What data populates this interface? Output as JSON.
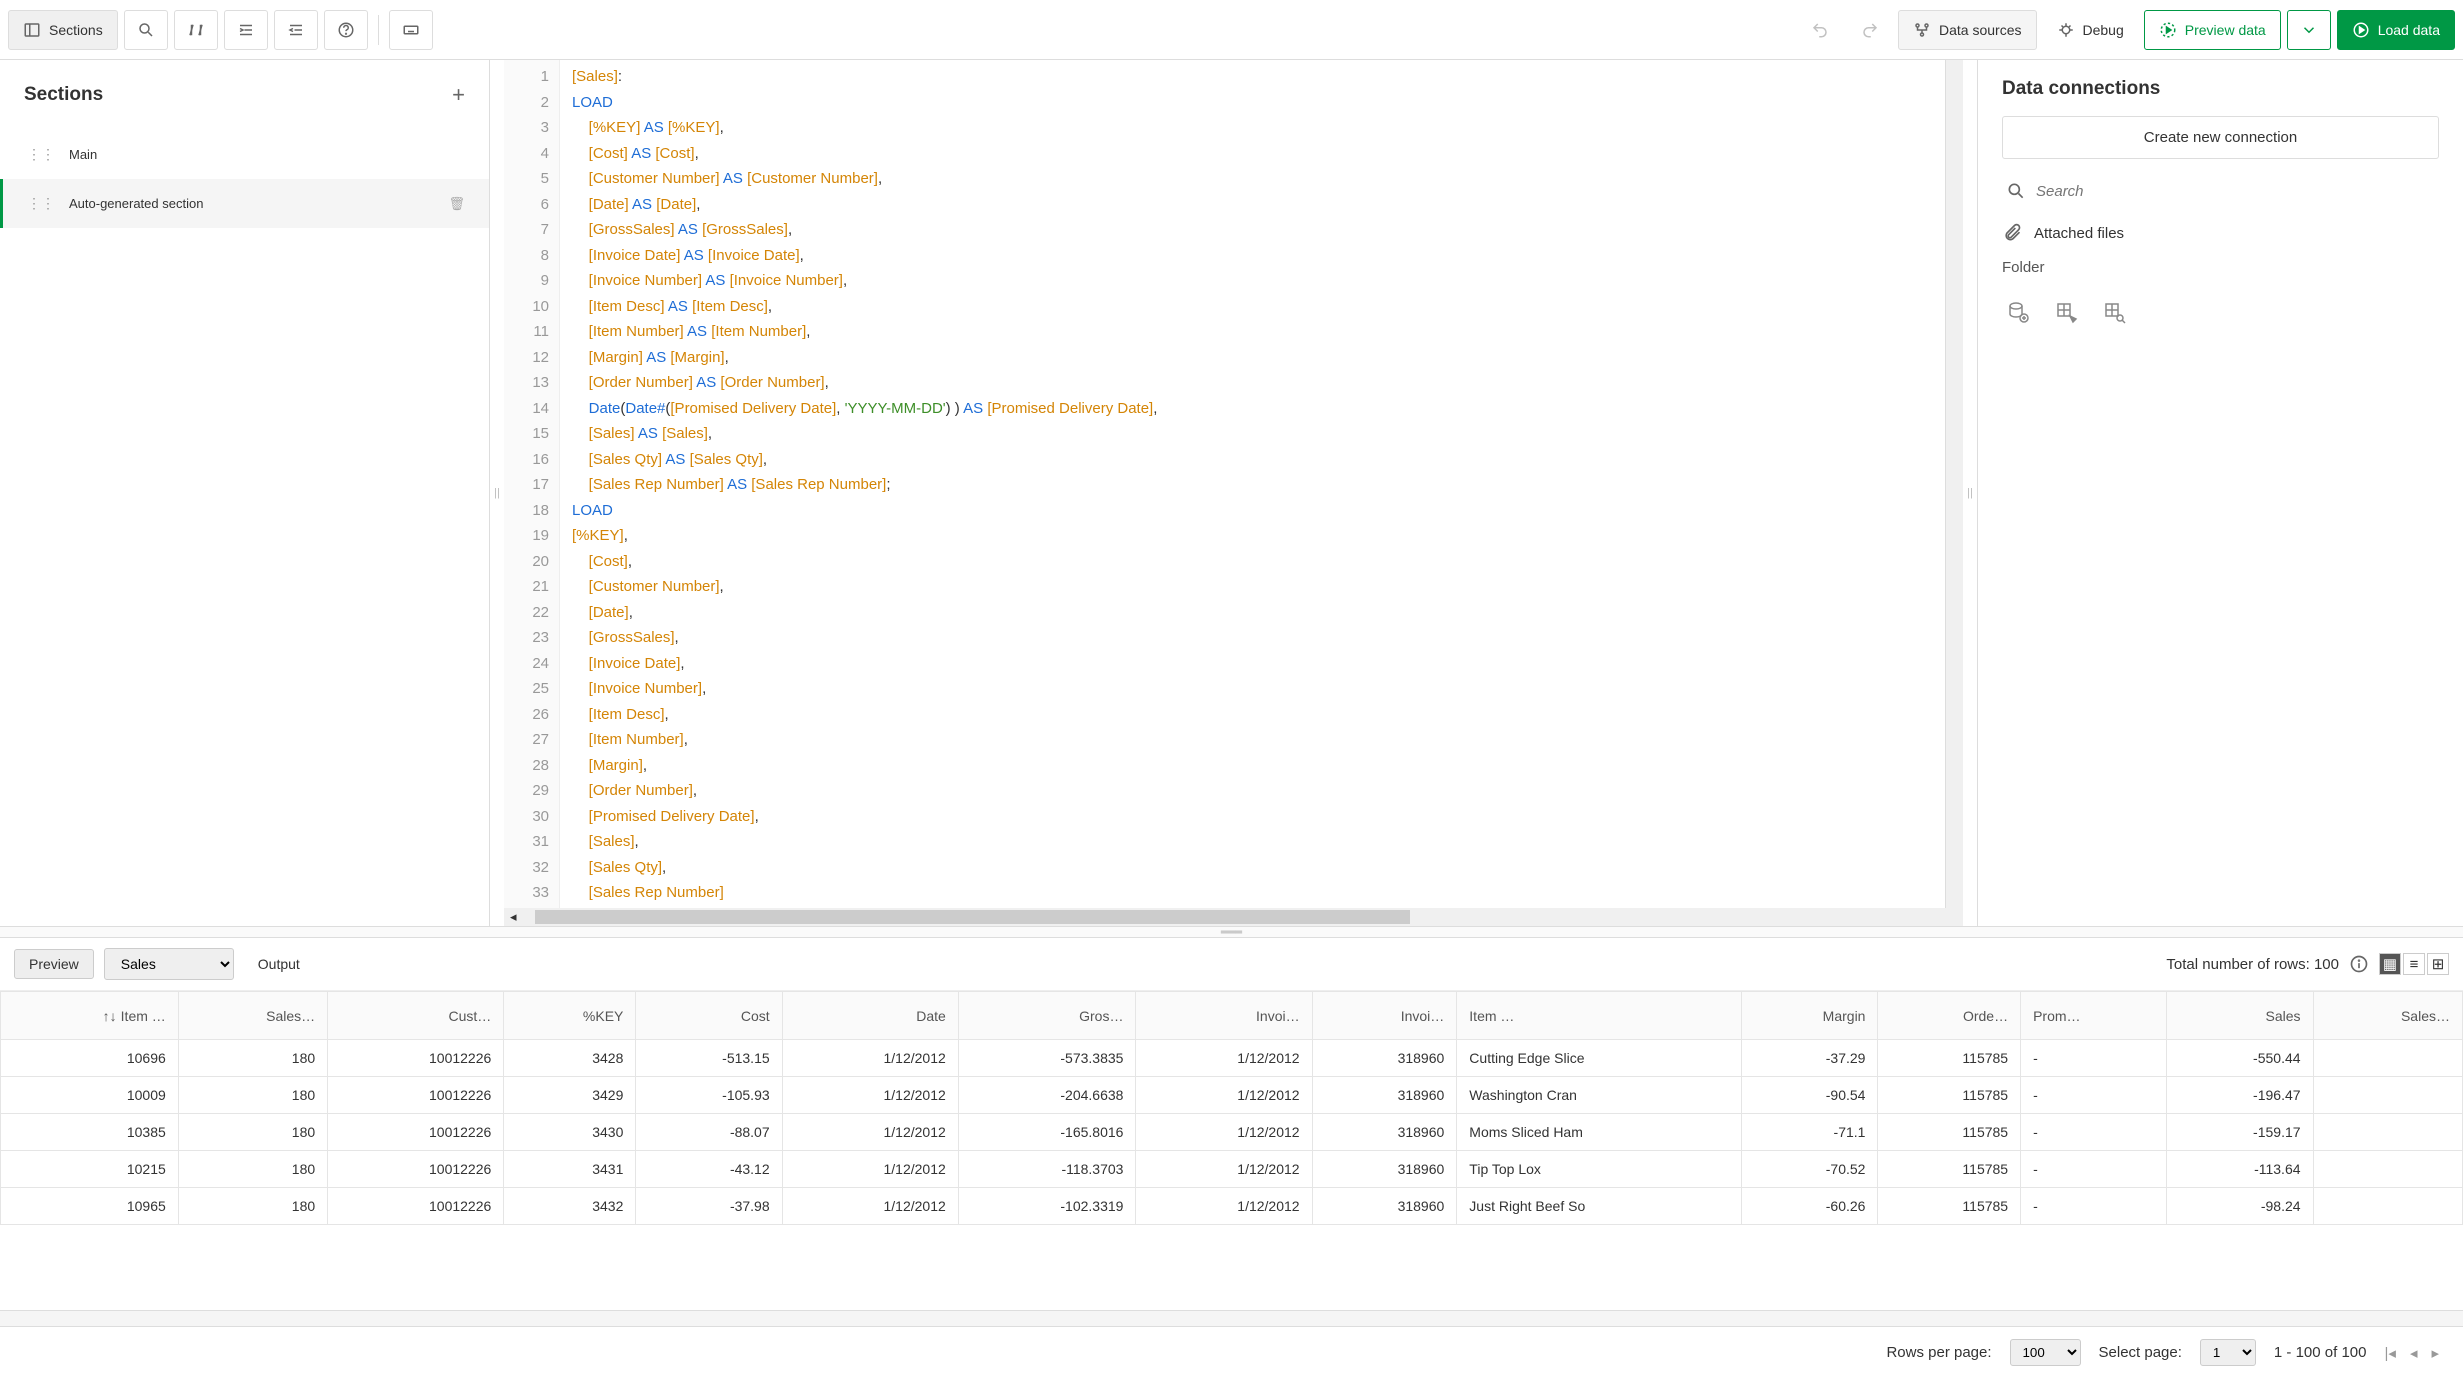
{
  "toolbar": {
    "sections_label": "Sections",
    "data_sources_label": "Data sources",
    "debug_label": "Debug",
    "preview_label": "Preview data",
    "load_label": "Load data"
  },
  "sidebar": {
    "title": "Sections",
    "items": [
      {
        "label": "Main"
      },
      {
        "label": "Auto-generated section"
      }
    ]
  },
  "editor": {
    "lines": [
      [
        {
          "t": "[Sales]",
          "c": "tk-orange"
        },
        {
          "t": ":",
          "c": ""
        }
      ],
      [
        {
          "t": "LOAD",
          "c": "tk-blue"
        }
      ],
      [
        {
          "t": "    ",
          "c": ""
        },
        {
          "t": "[%KEY]",
          "c": "tk-orange"
        },
        {
          "t": " ",
          "c": ""
        },
        {
          "t": "AS",
          "c": "tk-blue"
        },
        {
          "t": " ",
          "c": ""
        },
        {
          "t": "[%KEY]",
          "c": "tk-orange"
        },
        {
          "t": ",",
          "c": ""
        }
      ],
      [
        {
          "t": "    ",
          "c": ""
        },
        {
          "t": "[Cost]",
          "c": "tk-orange"
        },
        {
          "t": " ",
          "c": ""
        },
        {
          "t": "AS",
          "c": "tk-blue"
        },
        {
          "t": " ",
          "c": ""
        },
        {
          "t": "[Cost]",
          "c": "tk-orange"
        },
        {
          "t": ",",
          "c": ""
        }
      ],
      [
        {
          "t": "    ",
          "c": ""
        },
        {
          "t": "[Customer Number]",
          "c": "tk-orange"
        },
        {
          "t": " ",
          "c": ""
        },
        {
          "t": "AS",
          "c": "tk-blue"
        },
        {
          "t": " ",
          "c": ""
        },
        {
          "t": "[Customer Number]",
          "c": "tk-orange"
        },
        {
          "t": ",",
          "c": ""
        }
      ],
      [
        {
          "t": "    ",
          "c": ""
        },
        {
          "t": "[Date]",
          "c": "tk-orange"
        },
        {
          "t": " ",
          "c": ""
        },
        {
          "t": "AS",
          "c": "tk-blue"
        },
        {
          "t": " ",
          "c": ""
        },
        {
          "t": "[Date]",
          "c": "tk-orange"
        },
        {
          "t": ",",
          "c": ""
        }
      ],
      [
        {
          "t": "    ",
          "c": ""
        },
        {
          "t": "[GrossSales]",
          "c": "tk-orange"
        },
        {
          "t": " ",
          "c": ""
        },
        {
          "t": "AS",
          "c": "tk-blue"
        },
        {
          "t": " ",
          "c": ""
        },
        {
          "t": "[GrossSales]",
          "c": "tk-orange"
        },
        {
          "t": ",",
          "c": ""
        }
      ],
      [
        {
          "t": "    ",
          "c": ""
        },
        {
          "t": "[Invoice Date]",
          "c": "tk-orange"
        },
        {
          "t": " ",
          "c": ""
        },
        {
          "t": "AS",
          "c": "tk-blue"
        },
        {
          "t": " ",
          "c": ""
        },
        {
          "t": "[Invoice Date]",
          "c": "tk-orange"
        },
        {
          "t": ",",
          "c": ""
        }
      ],
      [
        {
          "t": "    ",
          "c": ""
        },
        {
          "t": "[Invoice Number]",
          "c": "tk-orange"
        },
        {
          "t": " ",
          "c": ""
        },
        {
          "t": "AS",
          "c": "tk-blue"
        },
        {
          "t": " ",
          "c": ""
        },
        {
          "t": "[Invoice Number]",
          "c": "tk-orange"
        },
        {
          "t": ",",
          "c": ""
        }
      ],
      [
        {
          "t": "    ",
          "c": ""
        },
        {
          "t": "[Item Desc]",
          "c": "tk-orange"
        },
        {
          "t": " ",
          "c": ""
        },
        {
          "t": "AS",
          "c": "tk-blue"
        },
        {
          "t": " ",
          "c": ""
        },
        {
          "t": "[Item Desc]",
          "c": "tk-orange"
        },
        {
          "t": ",",
          "c": ""
        }
      ],
      [
        {
          "t": "    ",
          "c": ""
        },
        {
          "t": "[Item Number]",
          "c": "tk-orange"
        },
        {
          "t": " ",
          "c": ""
        },
        {
          "t": "AS",
          "c": "tk-blue"
        },
        {
          "t": " ",
          "c": ""
        },
        {
          "t": "[Item Number]",
          "c": "tk-orange"
        },
        {
          "t": ",",
          "c": ""
        }
      ],
      [
        {
          "t": "    ",
          "c": ""
        },
        {
          "t": "[Margin]",
          "c": "tk-orange"
        },
        {
          "t": " ",
          "c": ""
        },
        {
          "t": "AS",
          "c": "tk-blue"
        },
        {
          "t": " ",
          "c": ""
        },
        {
          "t": "[Margin]",
          "c": "tk-orange"
        },
        {
          "t": ",",
          "c": ""
        }
      ],
      [
        {
          "t": "    ",
          "c": ""
        },
        {
          "t": "[Order Number]",
          "c": "tk-orange"
        },
        {
          "t": " ",
          "c": ""
        },
        {
          "t": "AS",
          "c": "tk-blue"
        },
        {
          "t": " ",
          "c": ""
        },
        {
          "t": "[Order Number]",
          "c": "tk-orange"
        },
        {
          "t": ",",
          "c": ""
        }
      ],
      [
        {
          "t": "    ",
          "c": ""
        },
        {
          "t": "Date",
          "c": "tk-blue"
        },
        {
          "t": "(",
          "c": ""
        },
        {
          "t": "Date#",
          "c": "tk-blue"
        },
        {
          "t": "(",
          "c": ""
        },
        {
          "t": "[Promised Delivery Date]",
          "c": "tk-orange"
        },
        {
          "t": ", ",
          "c": ""
        },
        {
          "t": "'YYYY-MM-DD'",
          "c": "tk-green"
        },
        {
          "t": ") ) ",
          "c": ""
        },
        {
          "t": "AS",
          "c": "tk-blue"
        },
        {
          "t": " ",
          "c": ""
        },
        {
          "t": "[Promised Delivery Date]",
          "c": "tk-orange"
        },
        {
          "t": ",",
          "c": ""
        }
      ],
      [
        {
          "t": "    ",
          "c": ""
        },
        {
          "t": "[Sales]",
          "c": "tk-orange"
        },
        {
          "t": " ",
          "c": ""
        },
        {
          "t": "AS",
          "c": "tk-blue"
        },
        {
          "t": " ",
          "c": ""
        },
        {
          "t": "[Sales]",
          "c": "tk-orange"
        },
        {
          "t": ",",
          "c": ""
        }
      ],
      [
        {
          "t": "    ",
          "c": ""
        },
        {
          "t": "[Sales Qty]",
          "c": "tk-orange"
        },
        {
          "t": " ",
          "c": ""
        },
        {
          "t": "AS",
          "c": "tk-blue"
        },
        {
          "t": " ",
          "c": ""
        },
        {
          "t": "[Sales Qty]",
          "c": "tk-orange"
        },
        {
          "t": ",",
          "c": ""
        }
      ],
      [
        {
          "t": "    ",
          "c": ""
        },
        {
          "t": "[Sales Rep Number]",
          "c": "tk-orange"
        },
        {
          "t": " ",
          "c": ""
        },
        {
          "t": "AS",
          "c": "tk-blue"
        },
        {
          "t": " ",
          "c": ""
        },
        {
          "t": "[Sales Rep Number]",
          "c": "tk-orange"
        },
        {
          "t": ";",
          "c": ""
        }
      ],
      [
        {
          "t": "LOAD",
          "c": "tk-blue"
        }
      ],
      [
        {
          "t": "[%KEY]",
          "c": "tk-orange"
        },
        {
          "t": ",",
          "c": ""
        }
      ],
      [
        {
          "t": "    ",
          "c": ""
        },
        {
          "t": "[Cost]",
          "c": "tk-orange"
        },
        {
          "t": ",",
          "c": ""
        }
      ],
      [
        {
          "t": "    ",
          "c": ""
        },
        {
          "t": "[Customer Number]",
          "c": "tk-orange"
        },
        {
          "t": ",",
          "c": ""
        }
      ],
      [
        {
          "t": "    ",
          "c": ""
        },
        {
          "t": "[Date]",
          "c": "tk-orange"
        },
        {
          "t": ",",
          "c": ""
        }
      ],
      [
        {
          "t": "    ",
          "c": ""
        },
        {
          "t": "[GrossSales]",
          "c": "tk-orange"
        },
        {
          "t": ",",
          "c": ""
        }
      ],
      [
        {
          "t": "    ",
          "c": ""
        },
        {
          "t": "[Invoice Date]",
          "c": "tk-orange"
        },
        {
          "t": ",",
          "c": ""
        }
      ],
      [
        {
          "t": "    ",
          "c": ""
        },
        {
          "t": "[Invoice Number]",
          "c": "tk-orange"
        },
        {
          "t": ",",
          "c": ""
        }
      ],
      [
        {
          "t": "    ",
          "c": ""
        },
        {
          "t": "[Item Desc]",
          "c": "tk-orange"
        },
        {
          "t": ",",
          "c": ""
        }
      ],
      [
        {
          "t": "    ",
          "c": ""
        },
        {
          "t": "[Item Number]",
          "c": "tk-orange"
        },
        {
          "t": ",",
          "c": ""
        }
      ],
      [
        {
          "t": "    ",
          "c": ""
        },
        {
          "t": "[Margin]",
          "c": "tk-orange"
        },
        {
          "t": ",",
          "c": ""
        }
      ],
      [
        {
          "t": "    ",
          "c": ""
        },
        {
          "t": "[Order Number]",
          "c": "tk-orange"
        },
        {
          "t": ",",
          "c": ""
        }
      ],
      [
        {
          "t": "    ",
          "c": ""
        },
        {
          "t": "[Promised Delivery Date]",
          "c": "tk-orange"
        },
        {
          "t": ",",
          "c": ""
        }
      ],
      [
        {
          "t": "    ",
          "c": ""
        },
        {
          "t": "[Sales]",
          "c": "tk-orange"
        },
        {
          "t": ",",
          "c": ""
        }
      ],
      [
        {
          "t": "    ",
          "c": ""
        },
        {
          "t": "[Sales Qty]",
          "c": "tk-orange"
        },
        {
          "t": ",",
          "c": ""
        }
      ],
      [
        {
          "t": "    ",
          "c": ""
        },
        {
          "t": "[Sales Rep Number]",
          "c": "tk-orange"
        }
      ],
      [
        {
          "t": "",
          "c": ""
        }
      ]
    ]
  },
  "right": {
    "title": "Data connections",
    "create_label": "Create new connection",
    "search_placeholder": "Search",
    "attached_label": "Attached files",
    "folder_label": "Folder"
  },
  "bottom": {
    "preview_tab": "Preview",
    "output_tab": "Output",
    "table_select": "Sales",
    "rows_label": "Total number of rows: 100",
    "columns": [
      "Item …",
      "Sales…",
      "Cust…",
      "%KEY",
      "Cost",
      "Date",
      "Gros…",
      "Invoi…",
      "Invoi…",
      "Item …",
      "Margin",
      "Orde…",
      "Prom…",
      "Sales",
      "Sales…"
    ],
    "col_align": [
      "r",
      "r",
      "r",
      "r",
      "r",
      "r",
      "r",
      "r",
      "r",
      "l",
      "r",
      "r",
      "l",
      "r",
      "r"
    ],
    "rows": [
      [
        "10696",
        "180",
        "10012226",
        "3428",
        "-513.15",
        "1/12/2012",
        "-573.3835",
        "1/12/2012",
        "318960",
        "Cutting Edge Slice",
        "-37.29",
        "115785",
        "-",
        "-550.44",
        ""
      ],
      [
        "10009",
        "180",
        "10012226",
        "3429",
        "-105.93",
        "1/12/2012",
        "-204.6638",
        "1/12/2012",
        "318960",
        "Washington Cran",
        "-90.54",
        "115785",
        "-",
        "-196.47",
        ""
      ],
      [
        "10385",
        "180",
        "10012226",
        "3430",
        "-88.07",
        "1/12/2012",
        "-165.8016",
        "1/12/2012",
        "318960",
        "Moms Sliced Ham",
        "-71.1",
        "115785",
        "-",
        "-159.17",
        ""
      ],
      [
        "10215",
        "180",
        "10012226",
        "3431",
        "-43.12",
        "1/12/2012",
        "-118.3703",
        "1/12/2012",
        "318960",
        "Tip Top Lox",
        "-70.52",
        "115785",
        "-",
        "-113.64",
        ""
      ],
      [
        "10965",
        "180",
        "10012226",
        "3432",
        "-37.98",
        "1/12/2012",
        "-102.3319",
        "1/12/2012",
        "318960",
        "Just Right Beef So",
        "-60.26",
        "115785",
        "-",
        "-98.24",
        ""
      ]
    ]
  },
  "footer": {
    "rpp_label": "Rows per page:",
    "rpp_value": "100",
    "selpage_label": "Select page:",
    "selpage_value": "1",
    "range": "1 - 100 of 100"
  }
}
